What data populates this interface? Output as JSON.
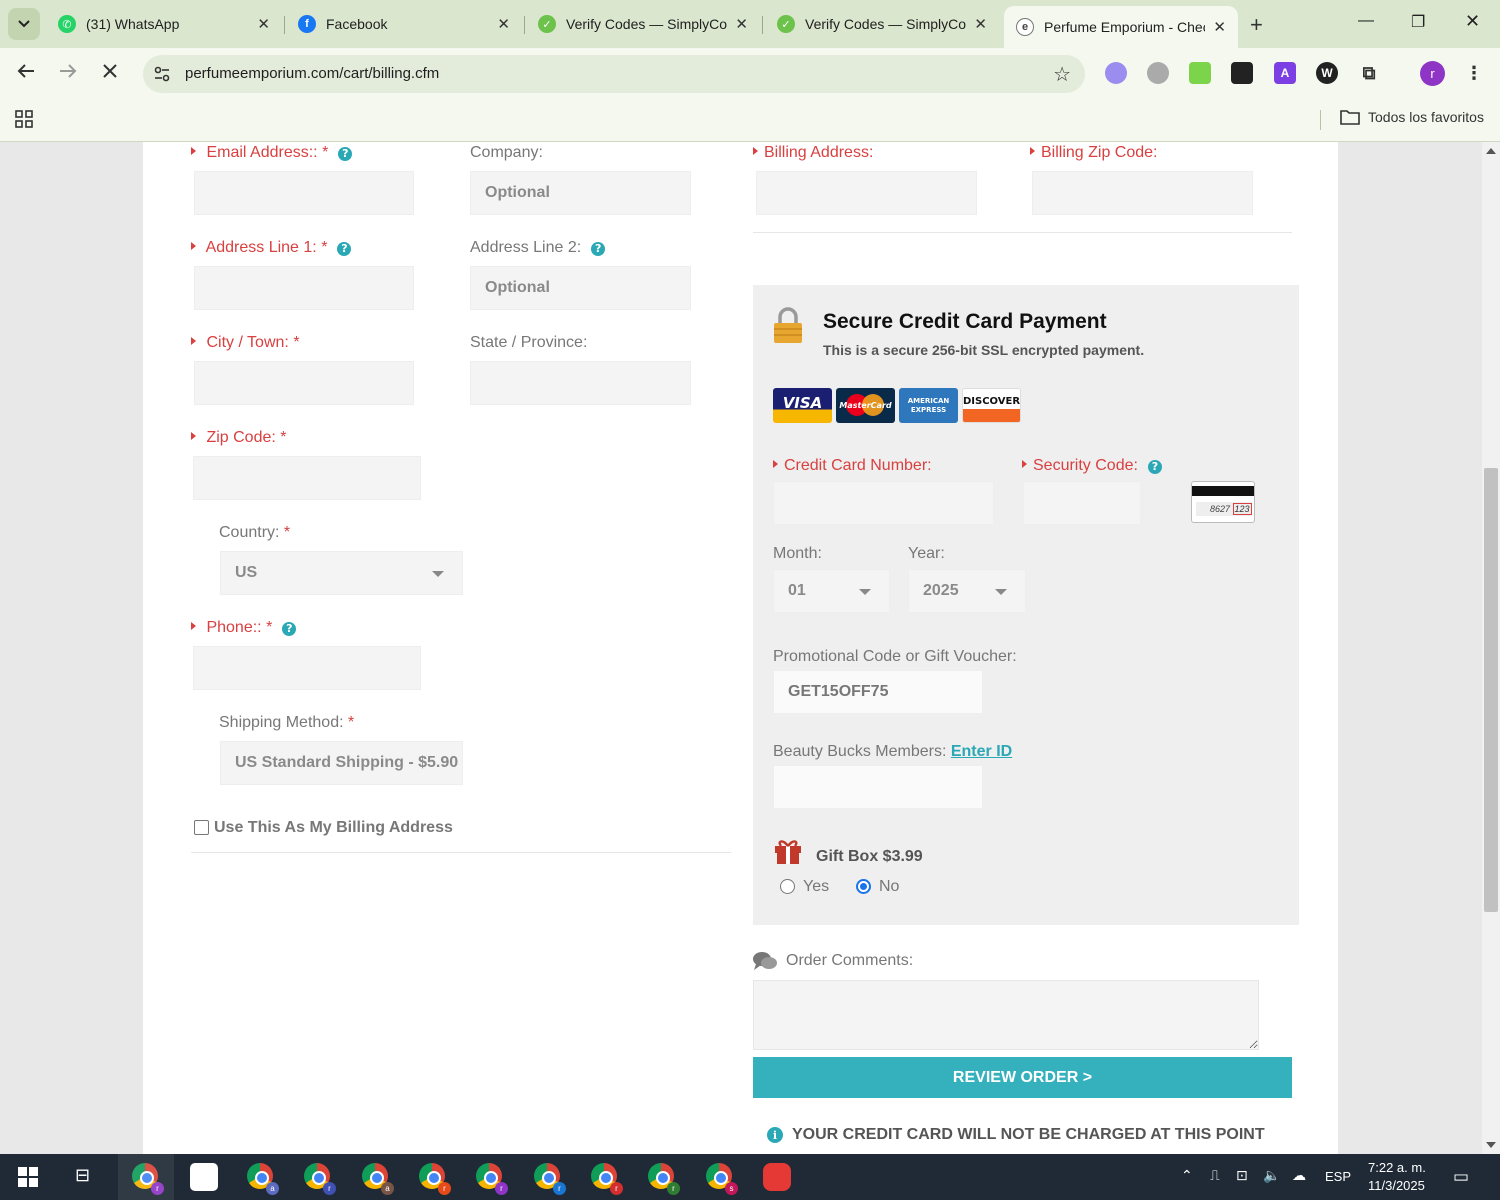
{
  "browser": {
    "tabs": [
      {
        "title": "(31) WhatsApp",
        "favicon_color": "#25d366"
      },
      {
        "title": "Facebook",
        "favicon_color": "#1877f2"
      },
      {
        "title": "Verify Codes — SimplyCodes",
        "favicon_color": "#6cc24a"
      },
      {
        "title": "Verify Codes — SimplyCodes",
        "favicon_color": "#6cc24a"
      },
      {
        "title": "Perfume Emporium - Checkout",
        "favicon_color": "#444444"
      }
    ],
    "url": "perfumeemporium.com/cart/billing.cfm",
    "bookmarks_folder": "Todos los favoritos",
    "profile_initial": "r"
  },
  "shipping_form": {
    "email_label": "Email Address::",
    "company_label": "Company:",
    "company_placeholder": "Optional",
    "address1_label": "Address Line 1:",
    "address2_label": "Address Line 2:",
    "address2_placeholder": "Optional",
    "city_label": "City / Town:",
    "state_label": "State / Province:",
    "zip_label": "Zip Code:",
    "country_label": "Country:",
    "country_value": "US",
    "phone_label": "Phone::",
    "shipping_method_label": "Shipping Method:",
    "shipping_method_value": "US Standard Shipping - $5.90",
    "use_as_billing_label": "Use This As My Billing Address",
    "required_mark": "*"
  },
  "billing_form": {
    "billing_address_label": "Billing Address:",
    "billing_zip_label": "Billing Zip Code:"
  },
  "payment": {
    "title": "Secure Credit Card Payment",
    "subtitle": "This is a secure 256-bit SSL encrypted payment.",
    "cards": [
      "VISA",
      "MasterCard",
      "AMERICAN EXPRESS",
      "DISCOVER"
    ],
    "card_number_label": "Credit Card Number:",
    "security_code_label": "Security Code:",
    "cvv_sample": "8627",
    "cvv_highlight": "123",
    "month_label": "Month:",
    "month_value": "01",
    "year_label": "Year:",
    "year_value": "2025",
    "promo_label": "Promotional Code or Gift Voucher:",
    "promo_value": "GET15OFF75",
    "beauty_label": "Beauty Bucks Members:",
    "beauty_link": "Enter ID",
    "giftbox_label": "Gift Box $3.99",
    "giftbox_yes": "Yes",
    "giftbox_no": "No",
    "giftbox_selected": "No"
  },
  "order": {
    "comments_label": "Order Comments:",
    "review_button": "REVIEW ORDER  >",
    "notice": "YOUR CREDIT CARD WILL NOT BE CHARGED AT THIS POINT"
  },
  "taskbar": {
    "language": "ESP",
    "time": "7:22 a. m.",
    "date": "11/3/2025"
  },
  "colors": {
    "required_red": "#d94040",
    "accent_teal": "#35b1bd",
    "help_teal": "#2aa8b5"
  }
}
